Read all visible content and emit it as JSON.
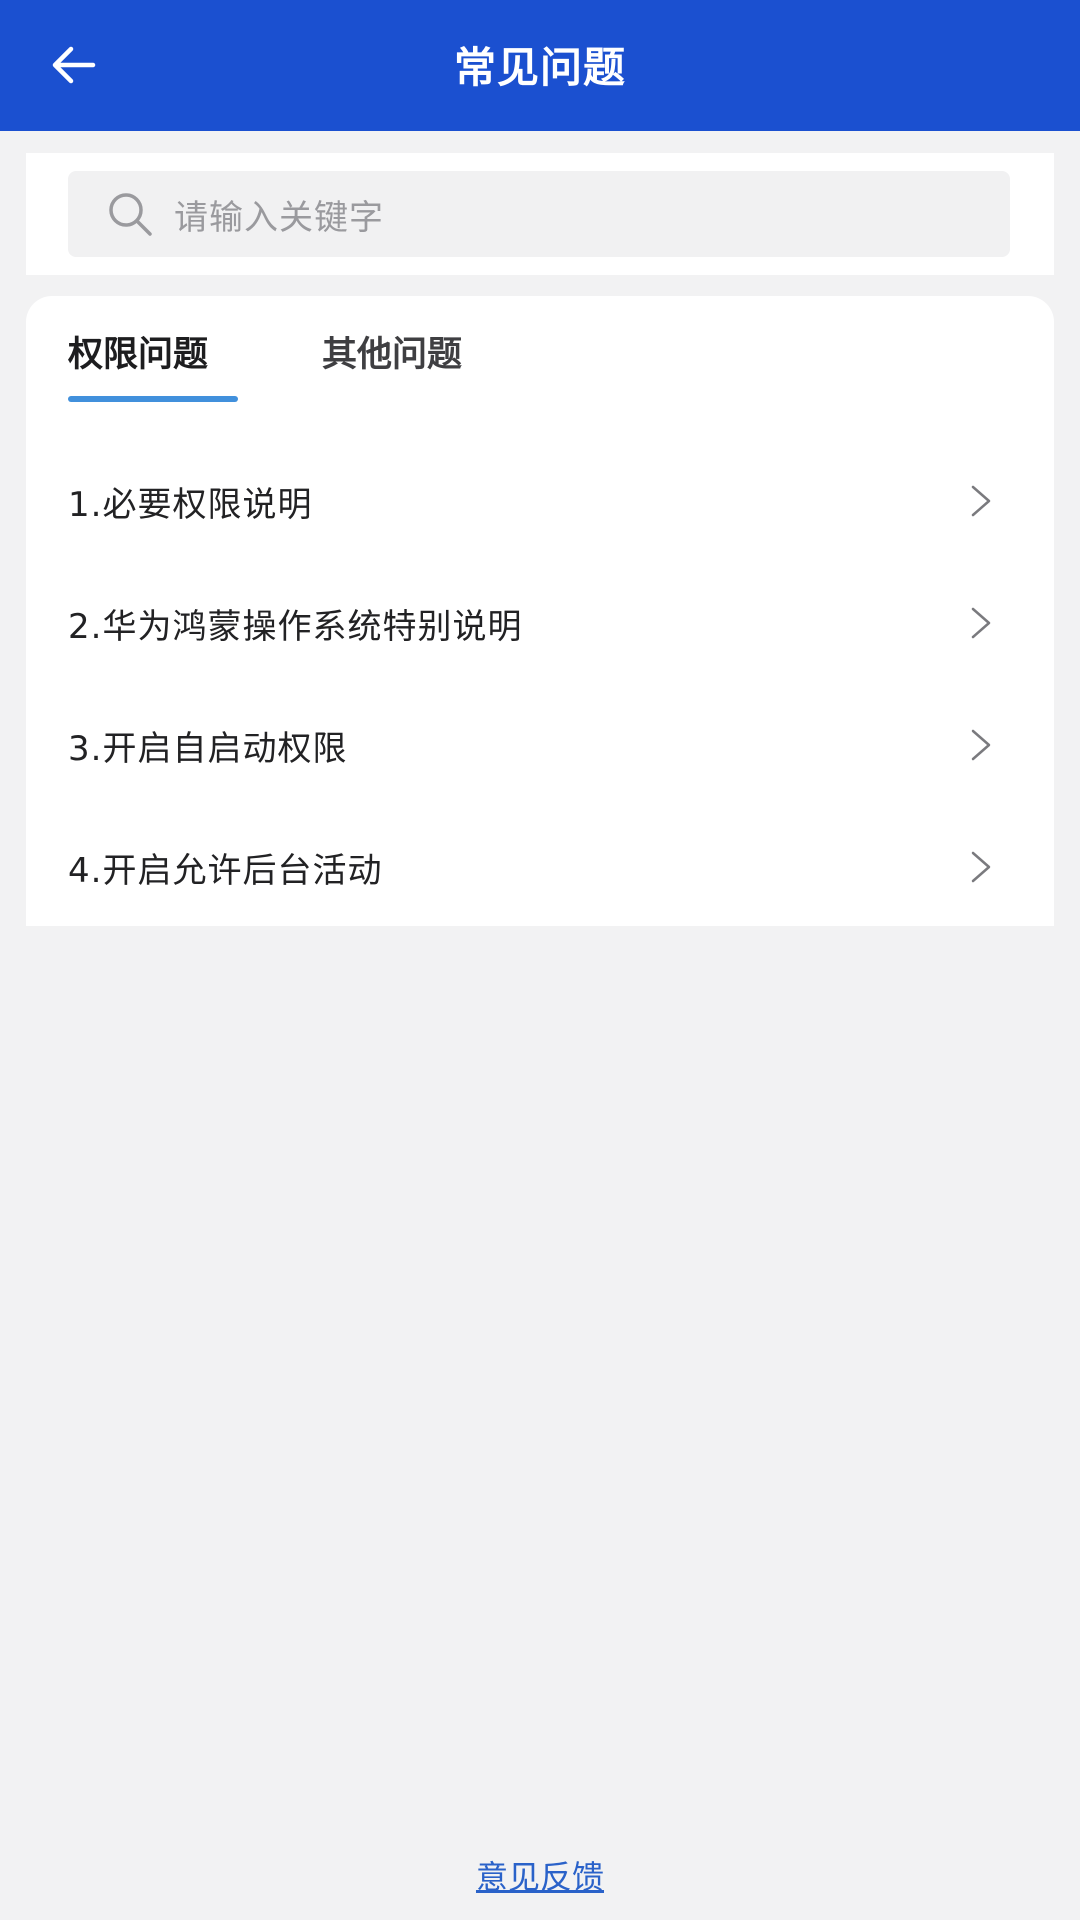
{
  "header": {
    "title": "常见问题",
    "back_icon": "arrow-left-icon",
    "background": "#1b50d0"
  },
  "search": {
    "placeholder": "请输入关键字",
    "icon": "search-icon"
  },
  "tabs": [
    {
      "label": "权限问题",
      "active": true
    },
    {
      "label": "其他问题",
      "active": false
    }
  ],
  "items": [
    {
      "label": "1.必要权限说明"
    },
    {
      "label": "2.华为鸿蒙操作系统特别说明"
    },
    {
      "label": "3.开启自启动权限"
    },
    {
      "label": "4.开启允许后台活动"
    }
  ],
  "footer": {
    "feedback_label": "意见反馈"
  },
  "colors": {
    "accent": "#4190dc",
    "link": "#2a62c9"
  }
}
